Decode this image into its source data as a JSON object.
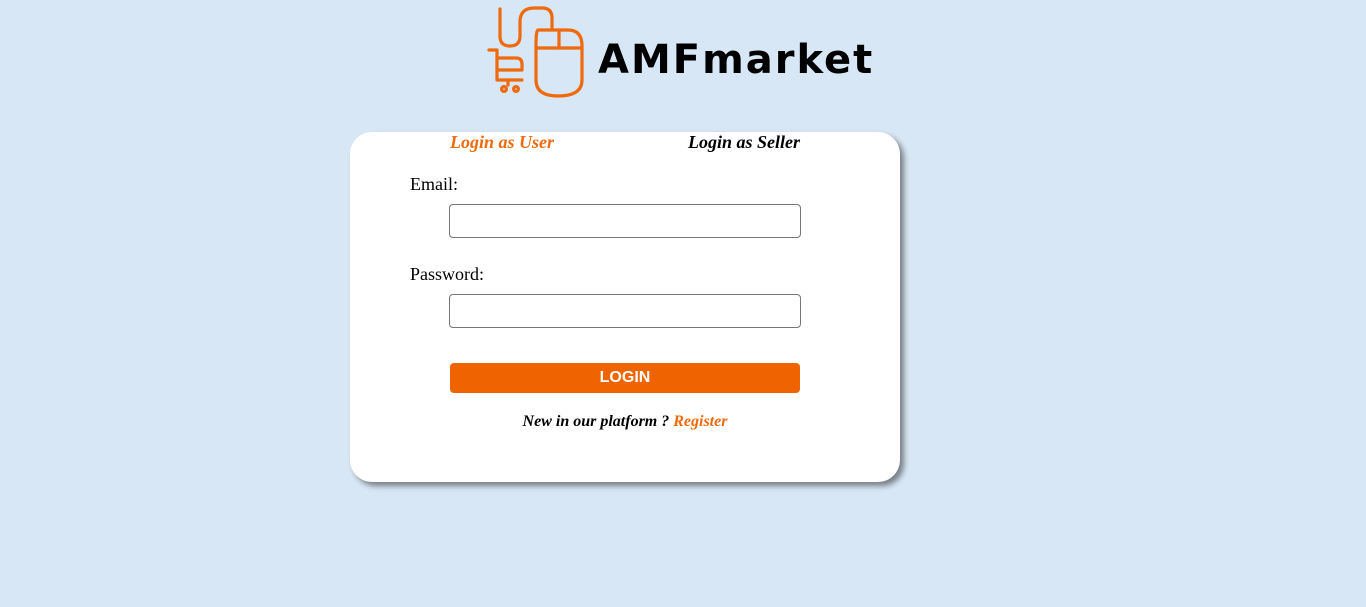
{
  "brand": {
    "name": "AMFmarket",
    "logo_icon": "mouse-cart-icon",
    "accent_color": "#ee6a0d"
  },
  "login": {
    "tabs": [
      {
        "label": "Login as User",
        "active": true
      },
      {
        "label": "Login as Seller",
        "active": false
      }
    ],
    "email_label": "Email:",
    "email_value": "",
    "password_label": "Password:",
    "password_value": "",
    "button_label": "LOGIN",
    "register_prompt": "New in our platform ?",
    "register_link": "Register"
  },
  "colors": {
    "background": "#d8e7f5",
    "card": "#ffffff",
    "button": "#f06400",
    "button_text": "#ffffff"
  }
}
